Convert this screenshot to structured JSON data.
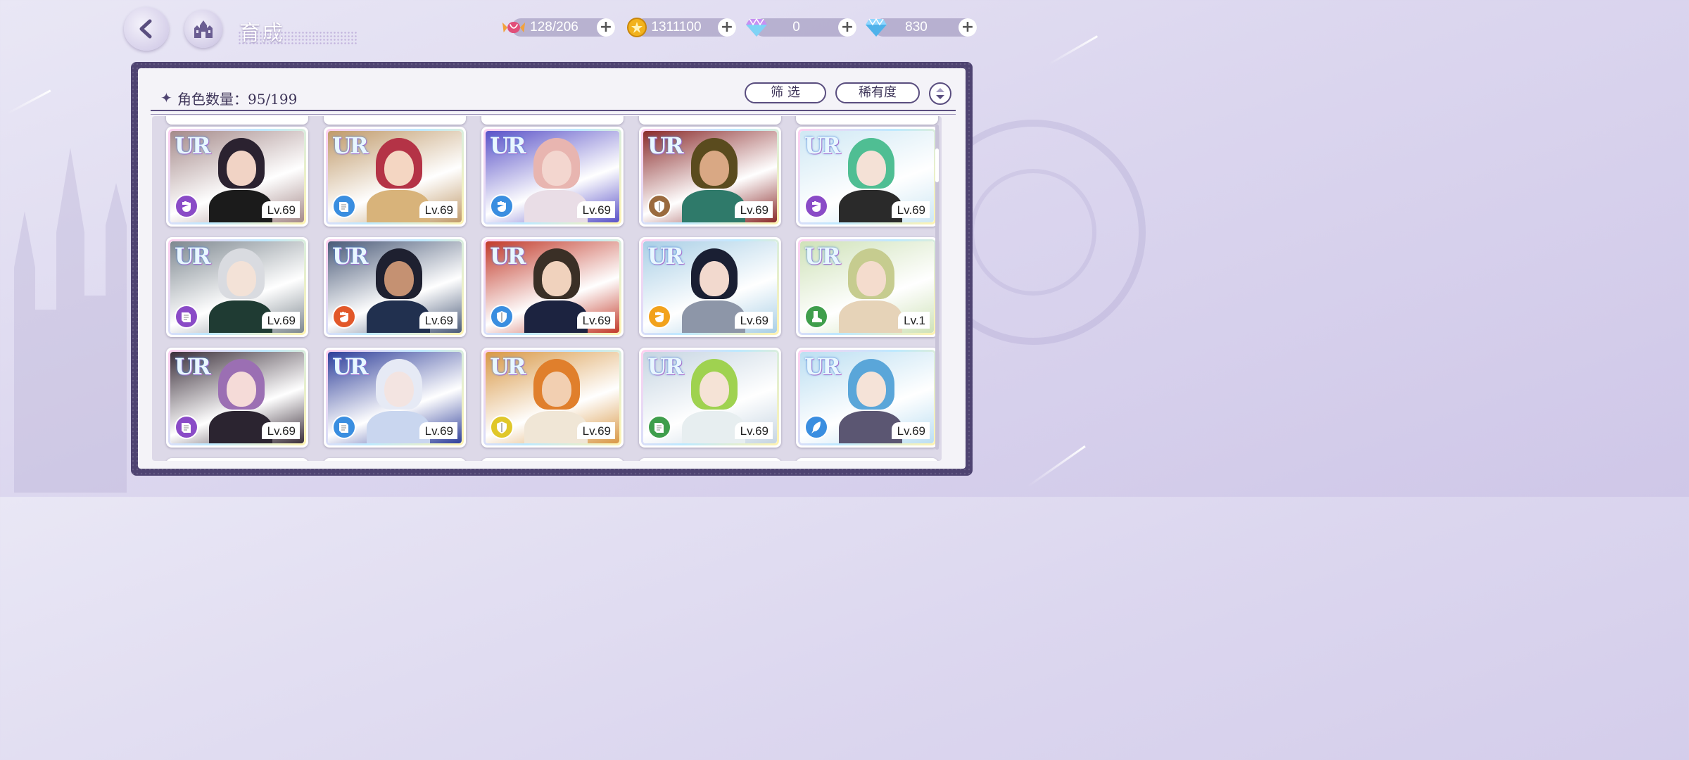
{
  "header": {
    "title": "育成",
    "title_script": "Growth"
  },
  "currencies": [
    {
      "name": "candy",
      "value": "128/206",
      "icon": "candy-icon",
      "color": "#e14f7a"
    },
    {
      "name": "gold",
      "value": "1311100",
      "icon": "coin-icon",
      "color": "#f2b21c"
    },
    {
      "name": "rainbow-gem",
      "value": "0",
      "icon": "rainbow-diamond-icon",
      "color": "#c78ff2"
    },
    {
      "name": "diamond",
      "value": "830",
      "icon": "diamond-icon",
      "color": "#8fd6ff"
    }
  ],
  "panel": {
    "count_label": "角色数量：95/199",
    "filter_label": "筛 选",
    "rarity_label": "稀有度"
  },
  "cards": [
    {
      "rarity": "UR",
      "level": "Lv.69",
      "class_color": "#8a4bc7",
      "class_icon": "fist-icon",
      "bg": "#a58a8a",
      "hair": "#2b2230",
      "skin": "#f1d3c5",
      "outfit": "#1b1b1b"
    },
    {
      "rarity": "UR",
      "level": "Lv.69",
      "class_color": "#3a8ee0",
      "class_icon": "book-icon",
      "bg": "#c09a6a",
      "hair": "#b43346",
      "skin": "#f4d6c2",
      "outfit": "#d8b37a"
    },
    {
      "rarity": "UR",
      "level": "Lv.69",
      "class_color": "#3a8ee0",
      "class_icon": "fist-icon",
      "bg": "#5a52c8",
      "hair": "#e8b5b0",
      "skin": "#f3d6cf",
      "outfit": "#e9dde6"
    },
    {
      "rarity": "UR",
      "level": "Lv.69",
      "class_color": "#9a6a3e",
      "class_icon": "shield-icon",
      "bg": "#8a2b2b",
      "hair": "#5a4b1e",
      "skin": "#d9a884",
      "outfit": "#2f7a6a"
    },
    {
      "rarity": "UR",
      "level": "Lv.69",
      "class_color": "#8a4bc7",
      "class_icon": "fist-icon",
      "bg": "#cfe8f4",
      "hair": "#4fbe93",
      "skin": "#f4e1d6",
      "outfit": "#2a2a2a"
    },
    {
      "rarity": "UR",
      "level": "Lv.69",
      "class_color": "#8a4bc7",
      "class_icon": "book-icon",
      "bg": "#7e8890",
      "hair": "#d9dbe0",
      "skin": "#f3e2d7",
      "outfit": "#1f3b33"
    },
    {
      "rarity": "UR",
      "level": "Lv.69",
      "class_color": "#e2582a",
      "class_icon": "fist-icon",
      "bg": "#4a5a78",
      "hair": "#1e2030",
      "skin": "#c59172",
      "outfit": "#21304f"
    },
    {
      "rarity": "UR",
      "level": "Lv.69",
      "class_color": "#3a8ee0",
      "class_icon": "shield-icon",
      "bg": "#c23a2a",
      "hair": "#3a2f26",
      "skin": "#f0d2bd",
      "outfit": "#1c2340"
    },
    {
      "rarity": "UR",
      "level": "Lv.69",
      "class_color": "#f2a21c",
      "class_icon": "fist-icon",
      "bg": "#a9cfe6",
      "hair": "#1a1f33",
      "skin": "#f2d9ce",
      "outfit": "#8d96a8"
    },
    {
      "rarity": "UR",
      "level": "Lv.1",
      "class_color": "#3f9e4c",
      "class_icon": "boot-icon",
      "bg": "#cfe2b8",
      "hair": "#c6cc8f",
      "skin": "#f4dccd",
      "outfit": "#e6d3b8"
    },
    {
      "rarity": "UR",
      "level": "Lv.69",
      "class_color": "#8a4bc7",
      "class_icon": "book-icon",
      "bg": "#3b2f3a",
      "hair": "#9b6fb3",
      "skin": "#f5dbd8",
      "outfit": "#2b2430"
    },
    {
      "rarity": "UR",
      "level": "Lv.69",
      "class_color": "#3a8ee0",
      "class_icon": "book-icon",
      "bg": "#2f3f9a",
      "hair": "#e6eaf5",
      "skin": "#f3e4e1",
      "outfit": "#c9d6ef"
    },
    {
      "rarity": "UR",
      "level": "Lv.69",
      "class_color": "#e0c72a",
      "class_icon": "shield-icon",
      "bg": "#d99846",
      "hair": "#e07f2c",
      "skin": "#f2cfb1",
      "outfit": "#f0e6d6"
    },
    {
      "rarity": "UR",
      "level": "Lv.69",
      "class_color": "#3f9e4c",
      "class_icon": "book-icon",
      "bg": "#c6d5e2",
      "hair": "#9fd250",
      "skin": "#f5e3d6",
      "outfit": "#e7eef0"
    },
    {
      "rarity": "UR",
      "level": "Lv.69",
      "class_color": "#3a8ee0",
      "class_icon": "feather-icon",
      "bg": "#bcdff2",
      "hair": "#5aa6d9",
      "skin": "#f5e3d8",
      "outfit": "#5b5672"
    }
  ]
}
